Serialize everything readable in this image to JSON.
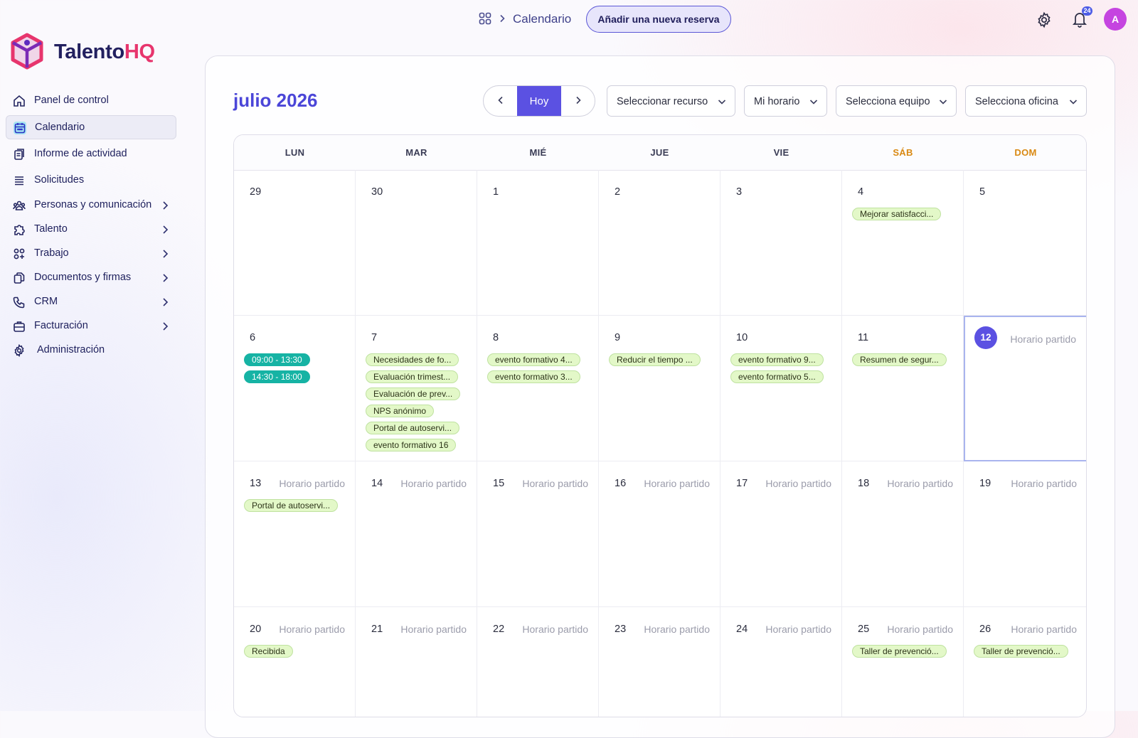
{
  "header": {
    "breadcrumb_title": "Calendario",
    "new_booking_label": "Añadir una nueva reserva",
    "notification_count": "24",
    "avatar_initial": "A"
  },
  "logo": {
    "part1": "Talento",
    "part2": "HQ"
  },
  "sidebar": {
    "items": [
      {
        "label": "Panel de control",
        "icon": "home-icon",
        "active": false,
        "expandable": false
      },
      {
        "label": "Calendario",
        "icon": "calendar-icon",
        "active": true,
        "expandable": false
      },
      {
        "label": "Informe de actividad",
        "icon": "report-icon",
        "active": false,
        "expandable": false
      },
      {
        "label": "Solicitudes",
        "icon": "list-icon",
        "active": false,
        "expandable": false
      },
      {
        "label": "Personas y comunicación",
        "icon": "people-icon",
        "active": false,
        "expandable": true
      },
      {
        "label": "Talento",
        "icon": "puzzle-icon",
        "active": false,
        "expandable": true
      },
      {
        "label": "Trabajo",
        "icon": "apps-icon",
        "active": false,
        "expandable": true
      },
      {
        "label": "Documentos y firmas",
        "icon": "documents-icon",
        "active": false,
        "expandable": true
      },
      {
        "label": "CRM",
        "icon": "phone-icon",
        "active": false,
        "expandable": true
      },
      {
        "label": "Facturación",
        "icon": "briefcase-icon",
        "active": false,
        "expandable": true
      },
      {
        "label": "Administración",
        "icon": "gear-icon",
        "active": false,
        "expandable": false
      }
    ]
  },
  "toolbar": {
    "month_title": "julio 2026",
    "today_label": "Hoy",
    "selects": [
      "Seleccionar recurso",
      "Mi horario",
      "Selecciona equipo",
      "Selecciona oficina"
    ]
  },
  "calendar": {
    "weekdays": [
      "LUN",
      "MAR",
      "MIÉ",
      "JUE",
      "VIE",
      "SÁB",
      "DOM"
    ],
    "weekend_color": "#d98913",
    "accent": "#5b51e2",
    "weeks": [
      [
        {
          "day": "29",
          "events": []
        },
        {
          "day": "30",
          "events": []
        },
        {
          "day": "1",
          "events": []
        },
        {
          "day": "2",
          "events": []
        },
        {
          "day": "3",
          "events": []
        },
        {
          "day": "4",
          "events": [
            {
              "label": "Mejorar satisfacci..."
            }
          ]
        },
        {
          "day": "5",
          "events": []
        }
      ],
      [
        {
          "day": "6",
          "events": [
            {
              "label": "09:00 - 13:30",
              "kind": "time"
            },
            {
              "label": "14:30 - 18:00",
              "kind": "time"
            }
          ]
        },
        {
          "day": "7",
          "events": [
            {
              "label": "Necesidades de fo..."
            },
            {
              "label": "Evaluación trimest..."
            },
            {
              "label": "Evaluación de prev..."
            },
            {
              "label": "NPS anónimo"
            },
            {
              "label": "Portal de autoservi..."
            },
            {
              "label": "evento formativo 16"
            }
          ]
        },
        {
          "day": "8",
          "events": [
            {
              "label": "evento formativo 4..."
            },
            {
              "label": "evento formativo 3..."
            }
          ]
        },
        {
          "day": "9",
          "events": [
            {
              "label": "Reducir el tiempo ..."
            }
          ]
        },
        {
          "day": "10",
          "events": [
            {
              "label": "evento formativo 9..."
            },
            {
              "label": "evento formativo 5..."
            }
          ]
        },
        {
          "day": "11",
          "events": [
            {
              "label": "Resumen de segur..."
            }
          ]
        },
        {
          "day": "12",
          "today": true,
          "shift": "Horario partido",
          "events": []
        }
      ],
      [
        {
          "day": "13",
          "shift": "Horario partido",
          "events": [
            {
              "label": "Portal de autoservi..."
            }
          ]
        },
        {
          "day": "14",
          "shift": "Horario partido",
          "events": []
        },
        {
          "day": "15",
          "shift": "Horario partido",
          "events": []
        },
        {
          "day": "16",
          "shift": "Horario partido",
          "events": []
        },
        {
          "day": "17",
          "shift": "Horario partido",
          "events": []
        },
        {
          "day": "18",
          "shift": "Horario partido",
          "events": []
        },
        {
          "day": "19",
          "shift": "Horario partido",
          "events": []
        }
      ],
      [
        {
          "day": "20",
          "shift": "Horario partido",
          "events": [
            {
              "label": "Recibida"
            }
          ]
        },
        {
          "day": "21",
          "shift": "Horario partido",
          "events": []
        },
        {
          "day": "22",
          "shift": "Horario partido",
          "events": []
        },
        {
          "day": "23",
          "shift": "Horario partido",
          "events": []
        },
        {
          "day": "24",
          "shift": "Horario partido",
          "events": []
        },
        {
          "day": "25",
          "shift": "Horario partido",
          "events": [
            {
              "label": "Taller de prevenció..."
            }
          ]
        },
        {
          "day": "26",
          "shift": "Horario partido",
          "events": [
            {
              "label": "Taller de prevenció..."
            }
          ]
        }
      ]
    ]
  }
}
